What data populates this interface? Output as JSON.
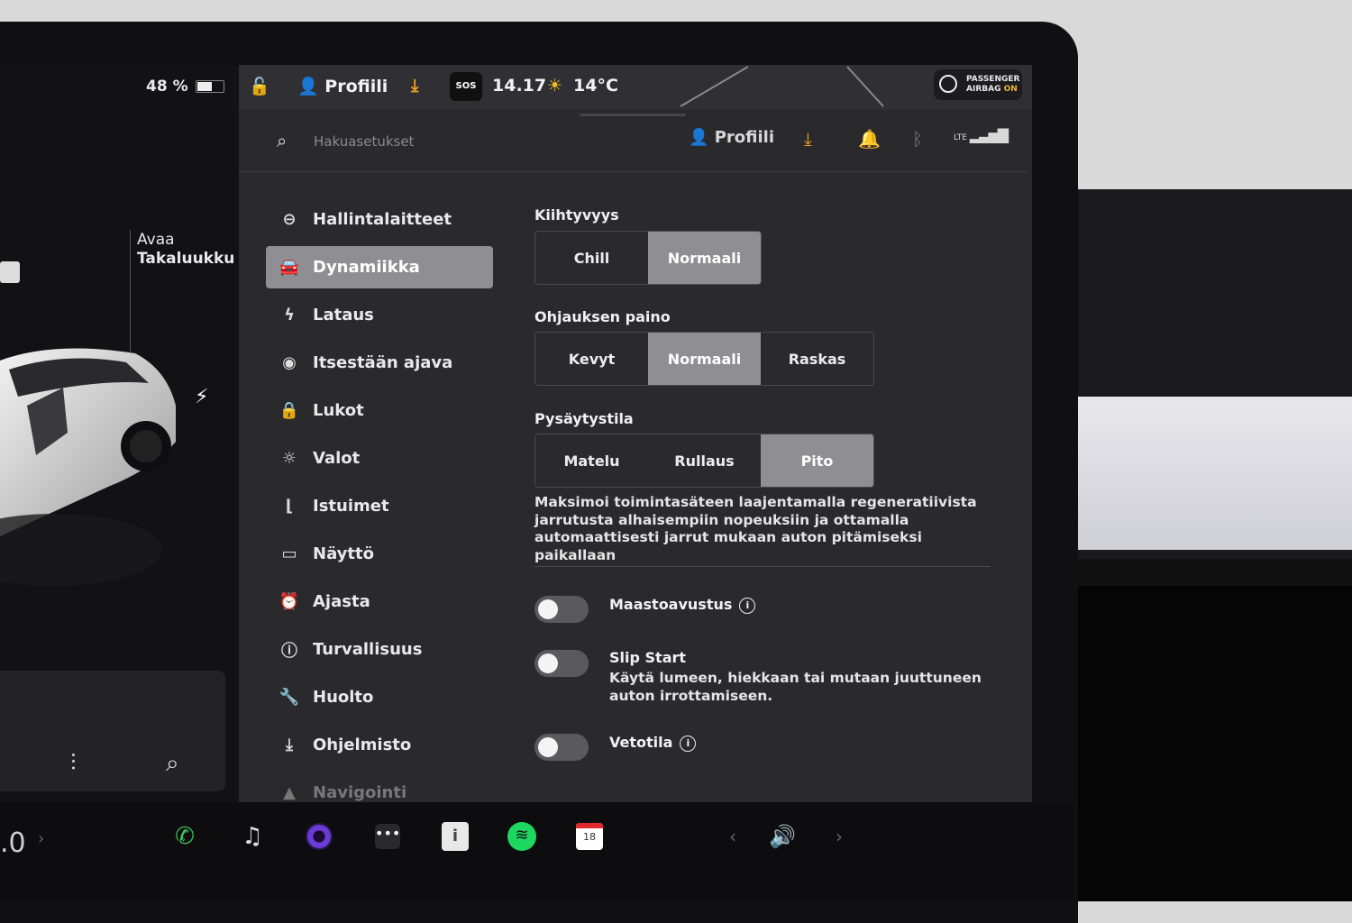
{
  "status": {
    "battery": "48 %",
    "profile_label": "Profiili",
    "sos": "SOS",
    "time": "14.17",
    "temperature": "14°C",
    "airbag_line1": "PASSENGER",
    "airbag_line2": "AIRBAG",
    "airbag_state": "ON"
  },
  "car_panel": {
    "trunk_line1": "Avaa",
    "trunk_line2": "Takaluukku"
  },
  "topbar": {
    "search_placeholder": "Hakuasetukset",
    "profile_label": "Profiili",
    "lte": "LTE"
  },
  "nav": {
    "items": [
      {
        "label": "Hallintalaitteet",
        "icon": "toggle-icon"
      },
      {
        "label": "Dynamiikka",
        "icon": "car-icon"
      },
      {
        "label": "Lataus",
        "icon": "bolt-icon"
      },
      {
        "label": "Itsestään ajava",
        "icon": "steering-wheel-icon"
      },
      {
        "label": "Lukot",
        "icon": "lock-icon"
      },
      {
        "label": "Valot",
        "icon": "light-icon"
      },
      {
        "label": "Istuimet",
        "icon": "seat-icon"
      },
      {
        "label": "Näyttö",
        "icon": "display-icon"
      },
      {
        "label": "Ajasta",
        "icon": "alarm-clock-icon"
      },
      {
        "label": "Turvallisuus",
        "icon": "safety-icon"
      },
      {
        "label": "Huolto",
        "icon": "wrench-icon"
      },
      {
        "label": "Ohjelmisto",
        "icon": "download-icon"
      },
      {
        "label": "Navigointi",
        "icon": "navigation-icon"
      }
    ],
    "active": "Dynamiikka"
  },
  "acceleration": {
    "title": "Kiihtyvyys",
    "options": [
      "Chill",
      "Normaali"
    ],
    "selected": "Normaali"
  },
  "steering": {
    "title": "Ohjauksen paino",
    "options": [
      "Kevyt",
      "Normaali",
      "Raskas"
    ],
    "selected": "Normaali"
  },
  "stopping": {
    "title": "Pysäytystila",
    "options": [
      "Matelu",
      "Rullaus",
      "Pito"
    ],
    "selected": "Pito",
    "description": "Maksimoi toimintasäteen laajentamalla regeneratiivista jarrutusta alhaisempiin nopeuksiin ja ottamalla automaattisesti jarrut mukaan auton pitämiseksi paikallaan"
  },
  "toggles": {
    "offroad": {
      "label": "Maastoavustus",
      "on": false
    },
    "slip_start": {
      "label": "Slip Start",
      "on": false,
      "description": "Käytä lumeen, hiekkaan tai mutaan juuttuneen auton irrottamiseen."
    },
    "tow": {
      "label": "Vetotila",
      "on": false
    }
  },
  "dock": {
    "speed": ".0",
    "calendar_day": "18"
  },
  "colors": {
    "selected_segment": "#8e8e93",
    "accent_orange": "#f0a020",
    "phone_green": "#3ec25a",
    "spotify_green": "#1ed760",
    "calendar_red": "#e0282e"
  }
}
